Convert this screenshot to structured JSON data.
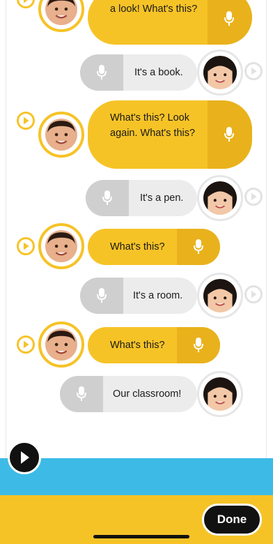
{
  "conversation": [
    {
      "speaker": "boy",
      "text": "a look! What's this?"
    },
    {
      "speaker": "girl",
      "text": "It's a book."
    },
    {
      "speaker": "boy",
      "text": "What's this? Look again. What's this?"
    },
    {
      "speaker": "girl",
      "text": "It's a pen."
    },
    {
      "speaker": "boy",
      "text": "What's this?"
    },
    {
      "speaker": "girl",
      "text": "It's a room."
    },
    {
      "speaker": "boy",
      "text": "What's this?"
    },
    {
      "speaker": "girl",
      "text": "Our classroom!"
    }
  ],
  "footer": {
    "done_label": "Done"
  },
  "colors": {
    "accent": "#f6c327",
    "band": "#3dbbe6",
    "dark": "#111111"
  }
}
